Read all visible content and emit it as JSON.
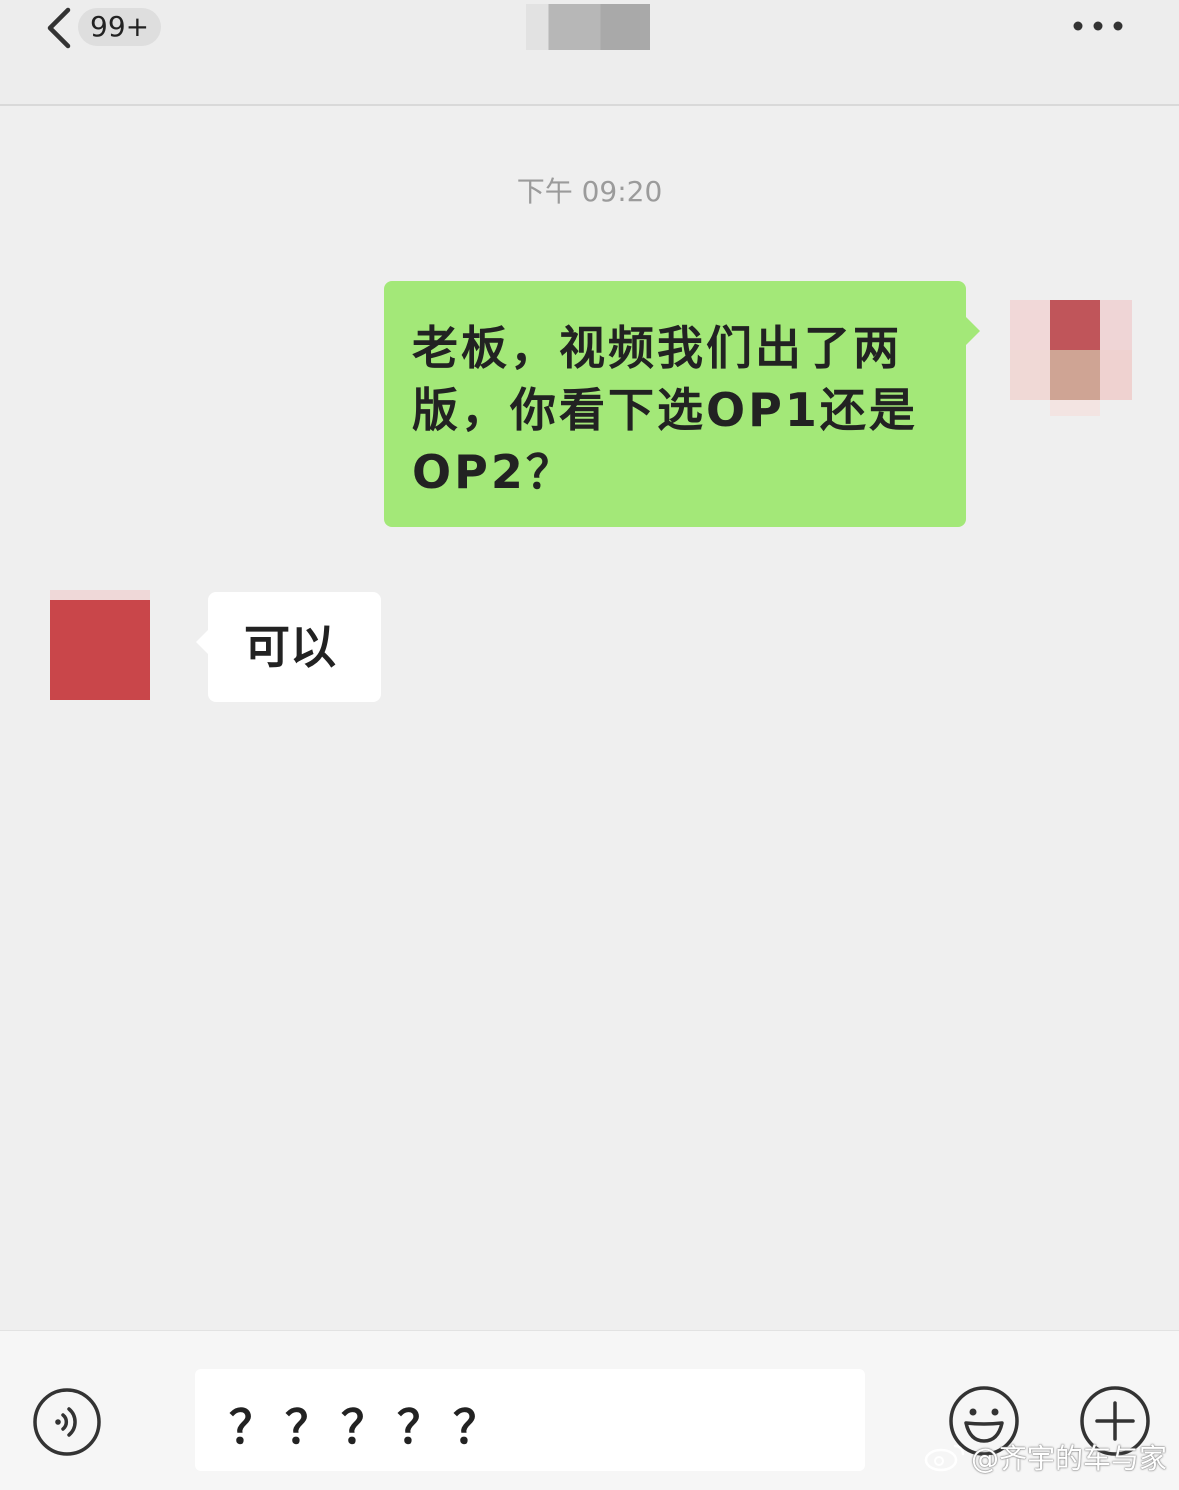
{
  "header": {
    "back_icon": "chevron-left-icon",
    "unread_count": "99+",
    "more_icon": "more-dots-icon"
  },
  "chat": {
    "timestamp": "下午 09:20",
    "messages": [
      {
        "direction": "outgoing",
        "text": "老板，视频我们出了两版，你看下选OP1还是OP2？",
        "bubble_color": "#a3e878"
      },
      {
        "direction": "incoming",
        "text": "可以",
        "bubble_color": "#ffffff"
      }
    ]
  },
  "input_bar": {
    "voice_icon": "voice-icon",
    "input_value": "？？？？？",
    "emoji_icon": "emoji-icon",
    "plus_icon": "plus-circle-icon"
  },
  "watermark": {
    "text": "@齐宇的车与家",
    "icon": "weibo-icon"
  }
}
